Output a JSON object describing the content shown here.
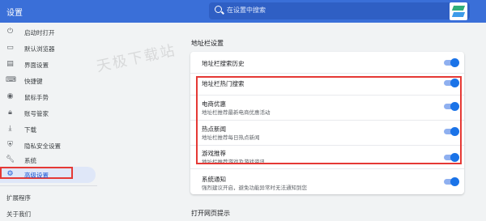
{
  "header": {
    "title": "设置",
    "search_placeholder": "在设置中搜索"
  },
  "sidebar": {
    "items": [
      {
        "icon": "power-icon",
        "label": "启动时打开"
      },
      {
        "icon": "browser-icon",
        "label": "默认浏览器"
      },
      {
        "icon": "layout-icon",
        "label": "界面设置"
      },
      {
        "icon": "keyboard-icon",
        "label": "快捷键"
      },
      {
        "icon": "mouse-icon",
        "label": "鼠标手势"
      },
      {
        "icon": "lock-icon",
        "label": "账号管家"
      },
      {
        "icon": "download-icon",
        "label": "下载"
      },
      {
        "icon": "shield-icon",
        "label": "隐私安全设置"
      },
      {
        "icon": "wrench-icon",
        "label": "系统"
      },
      {
        "icon": "gear-icon",
        "label": "高级设置"
      }
    ],
    "extensions": "扩展程序",
    "about": "关于我们"
  },
  "main": {
    "section_address": "地址栏设置",
    "rows": [
      {
        "title": "地址栏搜索历史",
        "sub": "",
        "on": true
      },
      {
        "title": "地址栏热门搜索",
        "sub": "",
        "on": true
      },
      {
        "title": "电商优惠",
        "sub": "地址栏推荐最新电商优惠活动",
        "on": true
      },
      {
        "title": "热点新闻",
        "sub": "地址栏推荐每日热点新闻",
        "on": true
      },
      {
        "title": "游戏推荐",
        "sub": "地址栏推荐游戏及游戏资讯",
        "on": true
      },
      {
        "title": "系统通知",
        "sub": "强烈建议开启，避免功能异常时无法通知到您",
        "on": true
      }
    ],
    "section_open_web": "打开网页提示"
  },
  "watermark": "天极下载站",
  "colors": {
    "header": "#3a6fd8",
    "toggle_on": "#1a73e8",
    "highlight": "#e53935"
  }
}
